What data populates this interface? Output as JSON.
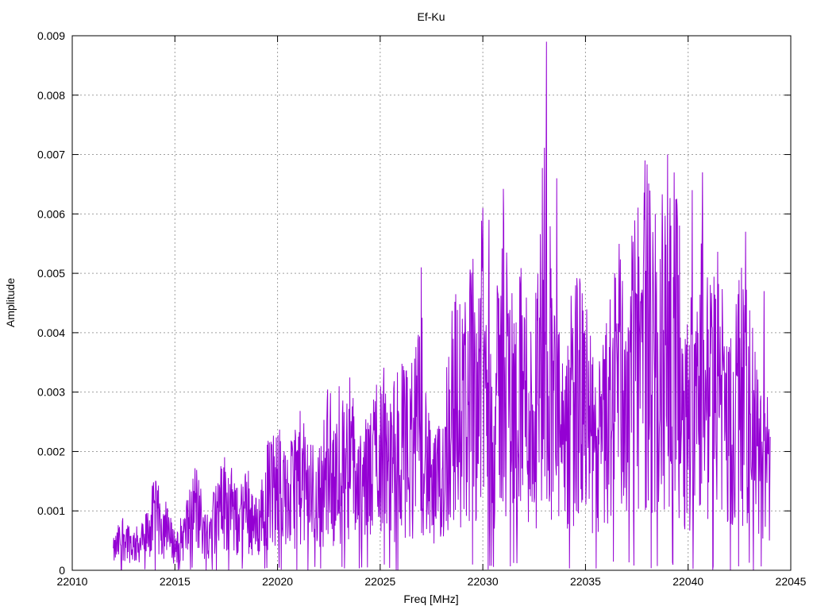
{
  "chart_data": {
    "type": "line",
    "title": "Ef-Ku",
    "xlabel": "Freq [MHz]",
    "ylabel": "Amplitude",
    "xlim": [
      22010,
      22045
    ],
    "ylim": [
      0,
      0.009
    ],
    "x_ticks": [
      "22010",
      "22015",
      "22020",
      "22025",
      "22030",
      "22035",
      "22040",
      "22045"
    ],
    "y_ticks": [
      "0",
      "0.001",
      "0.002",
      "0.003",
      "0.004",
      "0.005",
      "0.006",
      "0.007",
      "0.008",
      "0.009"
    ],
    "grid": true,
    "series": [
      {
        "color": "#9400d3",
        "x": [
          22012.0,
          22012.5,
          22013.0,
          22013.5,
          22014.0,
          22014.5,
          22015.0,
          22015.5,
          22016.0,
          22016.5,
          22017.0,
          22017.5,
          22018.0,
          22018.5,
          22019.0,
          22019.5,
          22020.0,
          22020.5,
          22021.0,
          22021.5,
          22022.0,
          22022.5,
          22023.0,
          22023.5,
          22024.0,
          22024.5,
          22025.0,
          22025.5,
          22026.0,
          22026.5,
          22027.0,
          22027.5,
          22028.0,
          22028.5,
          22029.0,
          22029.5,
          22030.0,
          22030.5,
          22031.0,
          22031.5,
          22032.0,
          22032.5,
          22033.0,
          22033.5,
          22034.0,
          22034.5,
          22035.0,
          22035.5,
          22036.0,
          22036.5,
          22037.0,
          22037.5,
          22038.0,
          22038.5,
          22039.0,
          22039.5,
          22040.0,
          22040.5,
          22041.0,
          22041.5,
          22042.0,
          22042.5,
          22043.0,
          22043.5,
          22044.0
        ],
        "y": [
          0.0003,
          0.0006,
          0.0004,
          0.0005,
          0.0009,
          0.0007,
          0.0004,
          0.0006,
          0.0011,
          0.0006,
          0.0009,
          0.0012,
          0.0008,
          0.001,
          0.0007,
          0.0013,
          0.0014,
          0.0011,
          0.0016,
          0.0013,
          0.0012,
          0.0018,
          0.0014,
          0.002,
          0.0013,
          0.0016,
          0.0022,
          0.0017,
          0.0021,
          0.0019,
          0.0025,
          0.0012,
          0.0015,
          0.0028,
          0.0026,
          0.0031,
          0.0034,
          0.0022,
          0.0036,
          0.0027,
          0.003,
          0.0023,
          0.0045,
          0.0028,
          0.0018,
          0.0031,
          0.0026,
          0.0019,
          0.0024,
          0.0033,
          0.0029,
          0.0036,
          0.004,
          0.0031,
          0.0042,
          0.0035,
          0.0024,
          0.0038,
          0.0028,
          0.0032,
          0.0022,
          0.003,
          0.0026,
          0.0018,
          0.0017
        ],
        "peaks": [
          {
            "x": 22023.0,
            "y": 0.0031
          },
          {
            "x": 22027.0,
            "y": 0.0051
          },
          {
            "x": 22030.0,
            "y": 0.0061
          },
          {
            "x": 22030.3,
            "y": 0.0059
          },
          {
            "x": 22033.1,
            "y": 0.0089
          },
          {
            "x": 22033.6,
            "y": 0.0066
          },
          {
            "x": 22037.9,
            "y": 0.0069
          },
          {
            "x": 22038.4,
            "y": 0.006
          },
          {
            "x": 22039.0,
            "y": 0.007
          },
          {
            "x": 22040.2,
            "y": 0.0064
          },
          {
            "x": 22040.7,
            "y": 0.0067
          },
          {
            "x": 22042.8,
            "y": 0.0057
          },
          {
            "x": 22043.7,
            "y": 0.0047
          }
        ]
      }
    ]
  }
}
